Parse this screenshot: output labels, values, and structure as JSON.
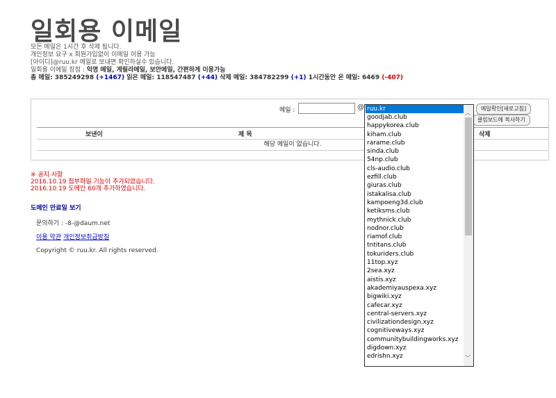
{
  "header": {
    "title": "일회용 이메일",
    "line1": "모든 메일은 1시간 후 삭제 됩니다.",
    "line2": "개인정보 요구 x 회원가입없이 이메일 이용 가능",
    "line3": "[아이디]@ruu.kr 메일로 보내면 확인하실수 있습니다.",
    "line4_prefix": "일회용 이메일 장점 : ",
    "line4_bold": "익명 메일, 게릴라메일, 보안메일, 간편하게 이용가능",
    "stats": {
      "total_label": "총 메일: ",
      "total": "385249298",
      "total_delta": "(+1467)",
      "read_label": " 읽은 메일: ",
      "read": "118547487",
      "read_delta": "(+44)",
      "deleted_label": " 삭제 메일: ",
      "deleted": "384782299",
      "deleted_delta": "(+1)",
      "hour_label": " 1시간동안 온 메일: ",
      "hour": "6469",
      "hour_delta": "(-407)"
    }
  },
  "mail_form": {
    "label": "메일 :",
    "input_value": "",
    "at": "@",
    "check_button": "메일확인[새로고침]",
    "copy_button": "클립보드에 복사하기"
  },
  "table": {
    "col_sender": "보낸이",
    "col_subject": "제 목",
    "col_delete": "삭제",
    "empty_message": "해당 메일이 없습니다."
  },
  "notice": {
    "title": "※ 공지 사항",
    "item1": "2016.10.19 첨부파일 기능이 추가되었습니다.",
    "item2": "2016.10.19 도메인 60개 추가하였습니다."
  },
  "footer": {
    "domain_expiry": "도메인 만료일 보기",
    "contact": "문의하기 : -8-@daum.net",
    "terms": "이용 약관",
    "privacy": "개인정보취급방침",
    "copyright": "Copyright © ruu.kr. All rights reserved."
  },
  "domain_dropdown": {
    "selected": "ruu.kr",
    "options": [
      "goodjab.club",
      "happykorea.club",
      "kiham.club",
      "rarame.club",
      "sinda.club",
      "54np.club",
      "cls-audio.club",
      "ezfill.club",
      "giuras.club",
      "istakalisa.club",
      "kampoeng3d.club",
      "ketiksms.club",
      "mythnick.club",
      "nodnor.club",
      "riamof.club",
      "tntitans.club",
      "tokuriders.club",
      "11top.xyz",
      "2sea.xyz",
      "aistis.xyz",
      "akademiyauspexa.xyz",
      "bigwiki.xyz",
      "cafecar.xyz",
      "central-servers.xyz",
      "civilizationdesign.xyz",
      "cognitiveways.xyz",
      "communitybuildingworks.xyz",
      "digdown.xyz",
      "edrishn.xyz"
    ]
  }
}
